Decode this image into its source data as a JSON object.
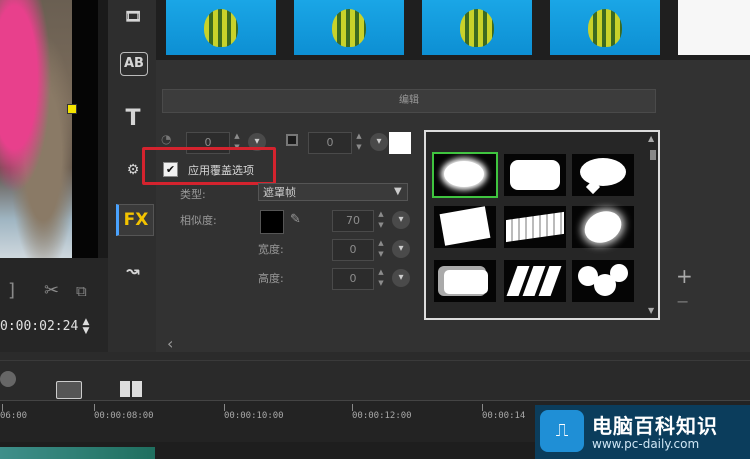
{
  "preview": {
    "timecode": "0:00:02:24"
  },
  "toolbar": {
    "tool_text_label": "T",
    "tool_fx_label": "FX",
    "tool_ab_label": "AB"
  },
  "edit_panel": {
    "header": "编辑",
    "top_value": "0",
    "border_value": "0",
    "apply_overlay_label": "应用覆盖选项",
    "apply_overlay_checked": true,
    "type_label": "类型:",
    "type_value": "遮罩帧",
    "similarity_label": "相似度:",
    "similarity_value": "70",
    "width_label": "宽度:",
    "width_value": "0",
    "height_label": "高度:",
    "height_value": "0",
    "back_arrow": "‹"
  },
  "gallery": {
    "mask_count": 9,
    "selected_index": 0
  },
  "right_ctrls": {
    "plus": "+",
    "minus": "−"
  },
  "timeline": {
    "ticks": [
      "06:00",
      "00:00:08:00",
      "00:00:10:00",
      "00:00:12:00",
      "00:00:14"
    ]
  },
  "watermark": {
    "title": "电脑百科知识",
    "url": "www.pc-daily.com"
  },
  "colors": {
    "accent_yellow": "#f3c300",
    "highlight_red": "#d4232e",
    "selection_green": "#3fc43f"
  }
}
